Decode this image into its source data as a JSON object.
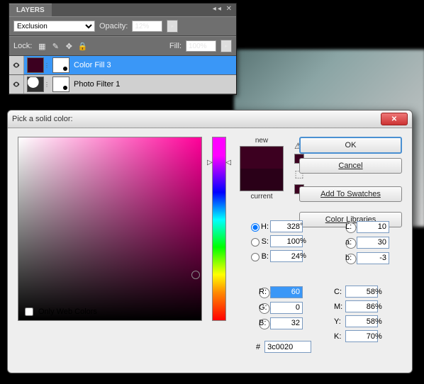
{
  "layers_panel": {
    "tab": "LAYERS",
    "blend_mode": "Exclusion",
    "opacity_label": "Opacity:",
    "opacity_value": "12%",
    "lock_label": "Lock:",
    "fill_label": "Fill:",
    "fill_value": "100%",
    "layers": [
      {
        "name": "Color Fill 3",
        "selected": true,
        "swatch": "#3c0020"
      },
      {
        "name": "Photo Filter 1",
        "selected": false
      }
    ]
  },
  "dialog": {
    "title": "Pick a solid color:",
    "new_label": "new",
    "current_label": "current",
    "buttons": {
      "ok": "OK",
      "cancel": "Cancel",
      "swatches": "Add To Swatches",
      "libraries": "Color Libraries"
    },
    "hsb": {
      "H": "328",
      "S": "100",
      "B": "24"
    },
    "rgb": {
      "R": "60",
      "G": "0",
      "B": "32"
    },
    "lab": {
      "L": "10",
      "a": "30",
      "b": "-3"
    },
    "cmyk": {
      "C": "58",
      "M": "86",
      "Y": "58",
      "K": "70"
    },
    "hex": "3c0020",
    "owc_label": "Only Web Colors",
    "degree": "°",
    "percent": "%",
    "hash": "#",
    "labels": {
      "H": "H:",
      "S": "S:",
      "Bv": "B:",
      "R": "R:",
      "G": "G:",
      "Bc": "B:",
      "L": "L:",
      "a": "a:",
      "b": "b:",
      "C": "C:",
      "M": "M:",
      "Y": "Y:",
      "K": "K:"
    }
  }
}
